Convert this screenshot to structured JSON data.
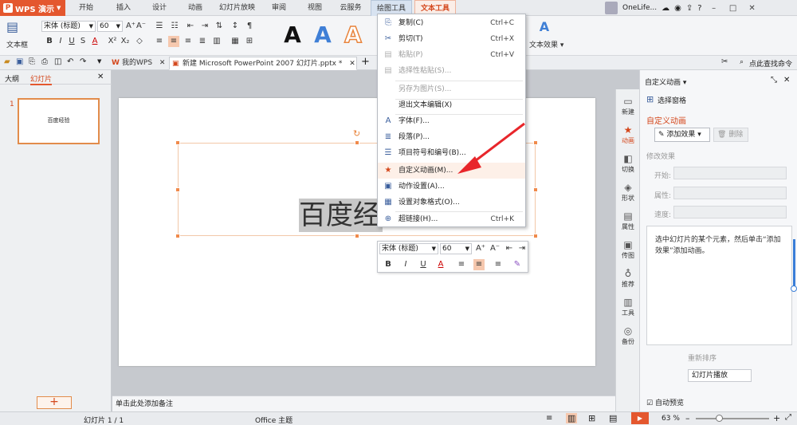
{
  "app": {
    "name": "WPS 演示"
  },
  "menu_tabs": [
    "开始",
    "插入",
    "设计",
    "动画",
    "幻灯片放映",
    "审阅",
    "视图",
    "云服务",
    "绘图工具",
    "文本工具"
  ],
  "user": {
    "name": "OneLife..."
  },
  "ribbon": {
    "textbox_label": "文本框",
    "font": "宋体 (标题)",
    "size": "60",
    "text_effect": "文本效果"
  },
  "doc_tabs": [
    {
      "label": "我的WPS"
    },
    {
      "label": "新建 Microsoft PowerPoint 2007 幻灯片.pptx *"
    }
  ],
  "search_cmd": "点此查找命令",
  "left_panel": {
    "tab_outline": "大纲",
    "tab_slides": "幻灯片",
    "slide_number": "1",
    "thumb_text": "百度经验"
  },
  "slide": {
    "text": "百度经验"
  },
  "context_menu": [
    {
      "label": "复制(C)",
      "shortcut": "Ctrl+C",
      "icon": "copy-icon",
      "disabled": false
    },
    {
      "label": "剪切(T)",
      "shortcut": "Ctrl+X",
      "icon": "scissors-icon",
      "disabled": false
    },
    {
      "label": "粘贴(P)",
      "shortcut": "Ctrl+V",
      "icon": "paste-icon",
      "disabled": true
    },
    {
      "label": "选择性粘贴(S)...",
      "shortcut": "",
      "icon": "paste-special-icon",
      "disabled": true
    },
    {
      "label": "另存为图片(S)...",
      "shortcut": "",
      "icon": "",
      "disabled": true
    },
    {
      "label": "退出文本编辑(X)",
      "shortcut": "",
      "icon": "",
      "disabled": false
    },
    {
      "label": "字体(F)...",
      "shortcut": "",
      "icon": "font-icon",
      "disabled": false
    },
    {
      "label": "段落(P)...",
      "shortcut": "",
      "icon": "paragraph-icon",
      "disabled": false
    },
    {
      "label": "项目符号和编号(B)...",
      "shortcut": "",
      "icon": "bullets-icon",
      "disabled": false
    },
    {
      "label": "自定义动画(M)...",
      "shortcut": "",
      "icon": "animation-icon",
      "disabled": false
    },
    {
      "label": "动作设置(A)...",
      "shortcut": "",
      "icon": "action-icon",
      "disabled": false
    },
    {
      "label": "设置对象格式(O)...",
      "shortcut": "",
      "icon": "format-icon",
      "disabled": false
    },
    {
      "label": "超链接(H)...",
      "shortcut": "Ctrl+K",
      "icon": "hyperlink-icon",
      "disabled": false
    }
  ],
  "mini_toolbar": {
    "font": "宋体 (标题)",
    "size": "60"
  },
  "sidebar": [
    {
      "label": "新建",
      "icon": "new-icon"
    },
    {
      "label": "动画",
      "icon": "animation-icon"
    },
    {
      "label": "切换",
      "icon": "transition-icon"
    },
    {
      "label": "形状",
      "icon": "shape-icon"
    },
    {
      "label": "属性",
      "icon": "property-icon"
    },
    {
      "label": "传图",
      "icon": "image-icon"
    },
    {
      "label": "推荐",
      "icon": "recommend-icon"
    },
    {
      "label": "工具",
      "icon": "tools-icon"
    },
    {
      "label": "备份",
      "icon": "backup-icon"
    }
  ],
  "task_pane": {
    "title": "自定义动画",
    "select_pane": "选择窗格",
    "section": "自定义动画",
    "add_effect": "添加效果",
    "delete": "删除",
    "modify": "修改效果",
    "start": "开始:",
    "property": "属性:",
    "speed": "速度:",
    "description": "选中幻灯片的某个元素，然后单击“添加效果”添加动画。",
    "reorder": "重新排序",
    "play": "幻灯片播放",
    "autopreview": "自动预览"
  },
  "notes_placeholder": "单击此处添加备注",
  "status": {
    "slide": "幻灯片 1 / 1",
    "theme": "Office 主题",
    "zoom": "63 %"
  },
  "colors": {
    "accent": "#e4572e",
    "menu_highlight": "#fdf0e8"
  }
}
